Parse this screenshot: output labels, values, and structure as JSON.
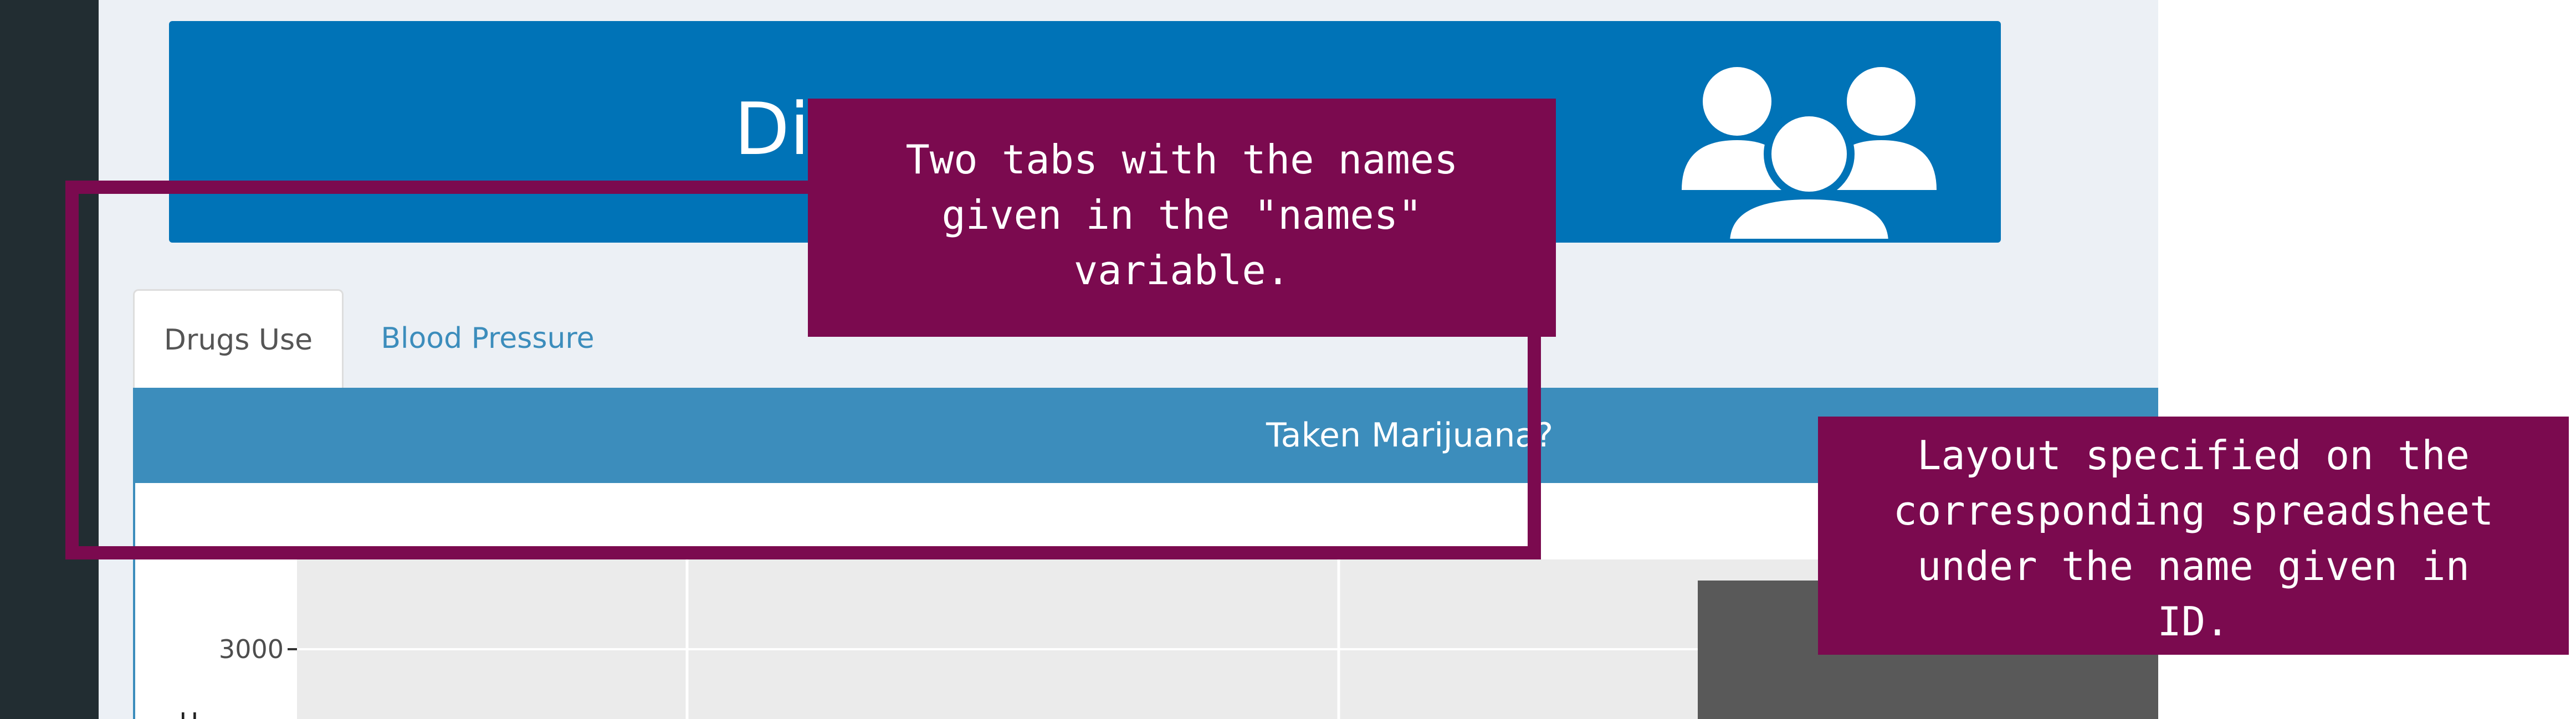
{
  "header": {
    "title_visible": "Dia",
    "icon": "users-group-icon",
    "background_color": "#0073b7"
  },
  "tabs": [
    {
      "label": "Drugs Use",
      "active": true
    },
    {
      "label": "Blood Pressure",
      "active": false
    }
  ],
  "panel": {
    "title": "Taken Marijuana?",
    "header_color": "#3c8dbc"
  },
  "chart_data": {
    "type": "bar",
    "y_tick_labels": [
      "3000"
    ],
    "ylabel_partial": "U",
    "bar_color": "#595959",
    "panel_background": "#ebebeb",
    "grid": true
  },
  "annotations": {
    "tabs_note": "Two tabs with the names\ngiven in the \"names\"\nvariable.",
    "layout_note": "Layout specified on the\ncorresponding spreadsheet\nunder the name given in\nID.",
    "color": "#7b0a4f"
  }
}
